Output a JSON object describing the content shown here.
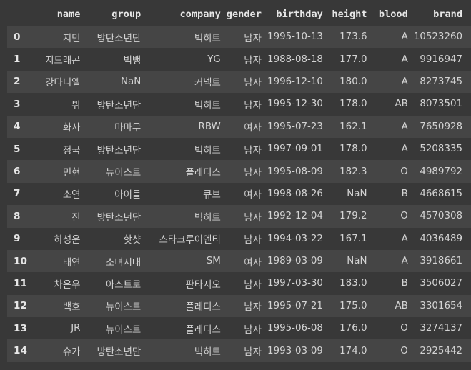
{
  "dataframe": {
    "columns": [
      "name",
      "group",
      "company",
      "gender",
      "birthday",
      "height",
      "blood",
      "brand"
    ],
    "rows": [
      {
        "index": "0",
        "name": "지민",
        "group": "방탄소년단",
        "company": "빅히트",
        "gender": "남자",
        "birthday": "1995-10-13",
        "height": "173.6",
        "blood": "A",
        "brand": "10523260"
      },
      {
        "index": "1",
        "name": "지드래곤",
        "group": "빅뱅",
        "company": "YG",
        "gender": "남자",
        "birthday": "1988-08-18",
        "height": "177.0",
        "blood": "A",
        "brand": "9916947"
      },
      {
        "index": "2",
        "name": "강다니엘",
        "group": "NaN",
        "company": "커넥트",
        "gender": "남자",
        "birthday": "1996-12-10",
        "height": "180.0",
        "blood": "A",
        "brand": "8273745"
      },
      {
        "index": "3",
        "name": "뷔",
        "group": "방탄소년단",
        "company": "빅히트",
        "gender": "남자",
        "birthday": "1995-12-30",
        "height": "178.0",
        "blood": "AB",
        "brand": "8073501"
      },
      {
        "index": "4",
        "name": "화사",
        "group": "마마무",
        "company": "RBW",
        "gender": "여자",
        "birthday": "1995-07-23",
        "height": "162.1",
        "blood": "A",
        "brand": "7650928"
      },
      {
        "index": "5",
        "name": "정국",
        "group": "방탄소년단",
        "company": "빅히트",
        "gender": "남자",
        "birthday": "1997-09-01",
        "height": "178.0",
        "blood": "A",
        "brand": "5208335"
      },
      {
        "index": "6",
        "name": "민현",
        "group": "뉴이스트",
        "company": "플레디스",
        "gender": "남자",
        "birthday": "1995-08-09",
        "height": "182.3",
        "blood": "O",
        "brand": "4989792"
      },
      {
        "index": "7",
        "name": "소연",
        "group": "아이들",
        "company": "큐브",
        "gender": "여자",
        "birthday": "1998-08-26",
        "height": "NaN",
        "blood": "B",
        "brand": "4668615"
      },
      {
        "index": "8",
        "name": "진",
        "group": "방탄소년단",
        "company": "빅히트",
        "gender": "남자",
        "birthday": "1992-12-04",
        "height": "179.2",
        "blood": "O",
        "brand": "4570308"
      },
      {
        "index": "9",
        "name": "하성운",
        "group": "핫샷",
        "company": "스타크루이엔티",
        "gender": "남자",
        "birthday": "1994-03-22",
        "height": "167.1",
        "blood": "A",
        "brand": "4036489"
      },
      {
        "index": "10",
        "name": "태연",
        "group": "소녀시대",
        "company": "SM",
        "gender": "여자",
        "birthday": "1989-03-09",
        "height": "NaN",
        "blood": "A",
        "brand": "3918661"
      },
      {
        "index": "11",
        "name": "차은우",
        "group": "아스트로",
        "company": "판타지오",
        "gender": "남자",
        "birthday": "1997-03-30",
        "height": "183.0",
        "blood": "B",
        "brand": "3506027"
      },
      {
        "index": "12",
        "name": "백호",
        "group": "뉴이스트",
        "company": "플레디스",
        "gender": "남자",
        "birthday": "1995-07-21",
        "height": "175.0",
        "blood": "AB",
        "brand": "3301654"
      },
      {
        "index": "13",
        "name": "JR",
        "group": "뉴이스트",
        "company": "플레디스",
        "gender": "남자",
        "birthday": "1995-06-08",
        "height": "176.0",
        "blood": "O",
        "brand": "3274137"
      },
      {
        "index": "14",
        "name": "슈가",
        "group": "방탄소년단",
        "company": "빅히트",
        "gender": "남자",
        "birthday": "1993-03-09",
        "height": "174.0",
        "blood": "O",
        "brand": "2925442"
      }
    ]
  },
  "colors": {
    "background": "#383838",
    "stripe": "#454545",
    "text": "#d3d3d3",
    "header_text": "#e6e6e6"
  }
}
